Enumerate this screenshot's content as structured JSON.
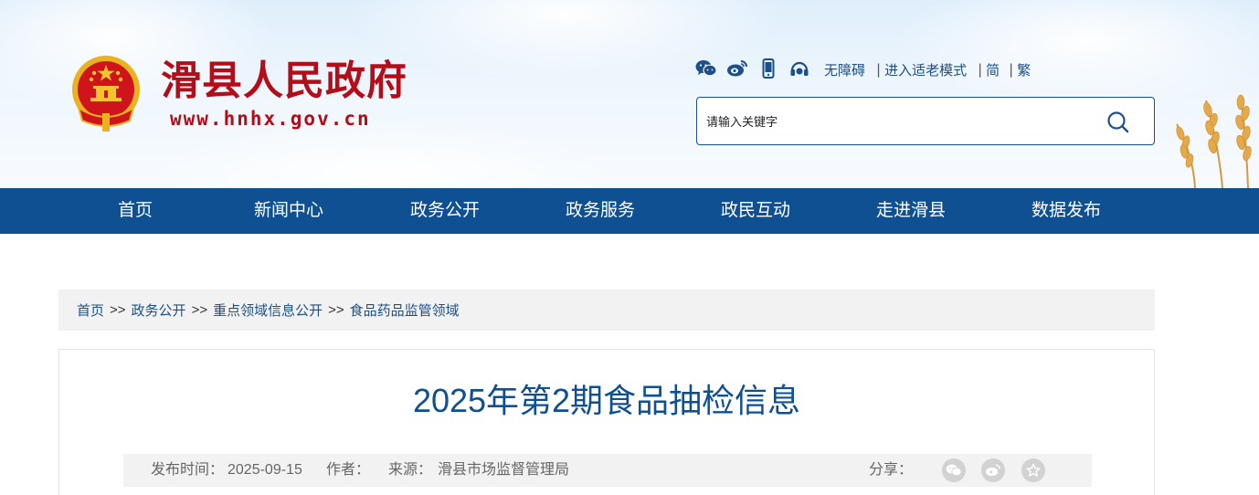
{
  "header": {
    "site_title": "滑县人民政府",
    "site_url": "www.hnhx.gov.cn",
    "tool_icons": [
      "wechat-icon",
      "weibo-icon",
      "mobile-icon",
      "headset-icon"
    ],
    "links": {
      "accessibility": "无障碍",
      "elder_mode": "进入适老模式",
      "simplified": "简",
      "traditional": "繁",
      "separator": "|"
    },
    "search": {
      "placeholder": "请输入关键字",
      "icon": "search-icon"
    }
  },
  "nav": {
    "items": [
      {
        "label": "首页"
      },
      {
        "label": "新闻中心"
      },
      {
        "label": "政务公开"
      },
      {
        "label": "政务服务"
      },
      {
        "label": "政民互动"
      },
      {
        "label": "走进滑县"
      },
      {
        "label": "数据发布"
      }
    ]
  },
  "breadcrumb": {
    "items": [
      "首页",
      "政务公开",
      "重点领域信息公开",
      "食品药品监管领域"
    ],
    "separator": ">>"
  },
  "article": {
    "title": "2025年第2期食品抽检信息",
    "meta": {
      "publish_label": "发布时间：",
      "publish_date": "2025-09-15",
      "author_label": "作者：",
      "author": "",
      "source_label": "来源：",
      "source": "滑县市场监督管理局",
      "share_label": "分享：",
      "share_icons": [
        "wechat-share-icon",
        "weibo-share-icon",
        "favorite-share-icon"
      ]
    }
  },
  "colors": {
    "brand_red": "#b40d1a",
    "nav_blue": "#0e5091",
    "link_blue": "#1d4f8a",
    "title_blue": "#0e5091",
    "gray_bar": "#f2f2f2"
  }
}
